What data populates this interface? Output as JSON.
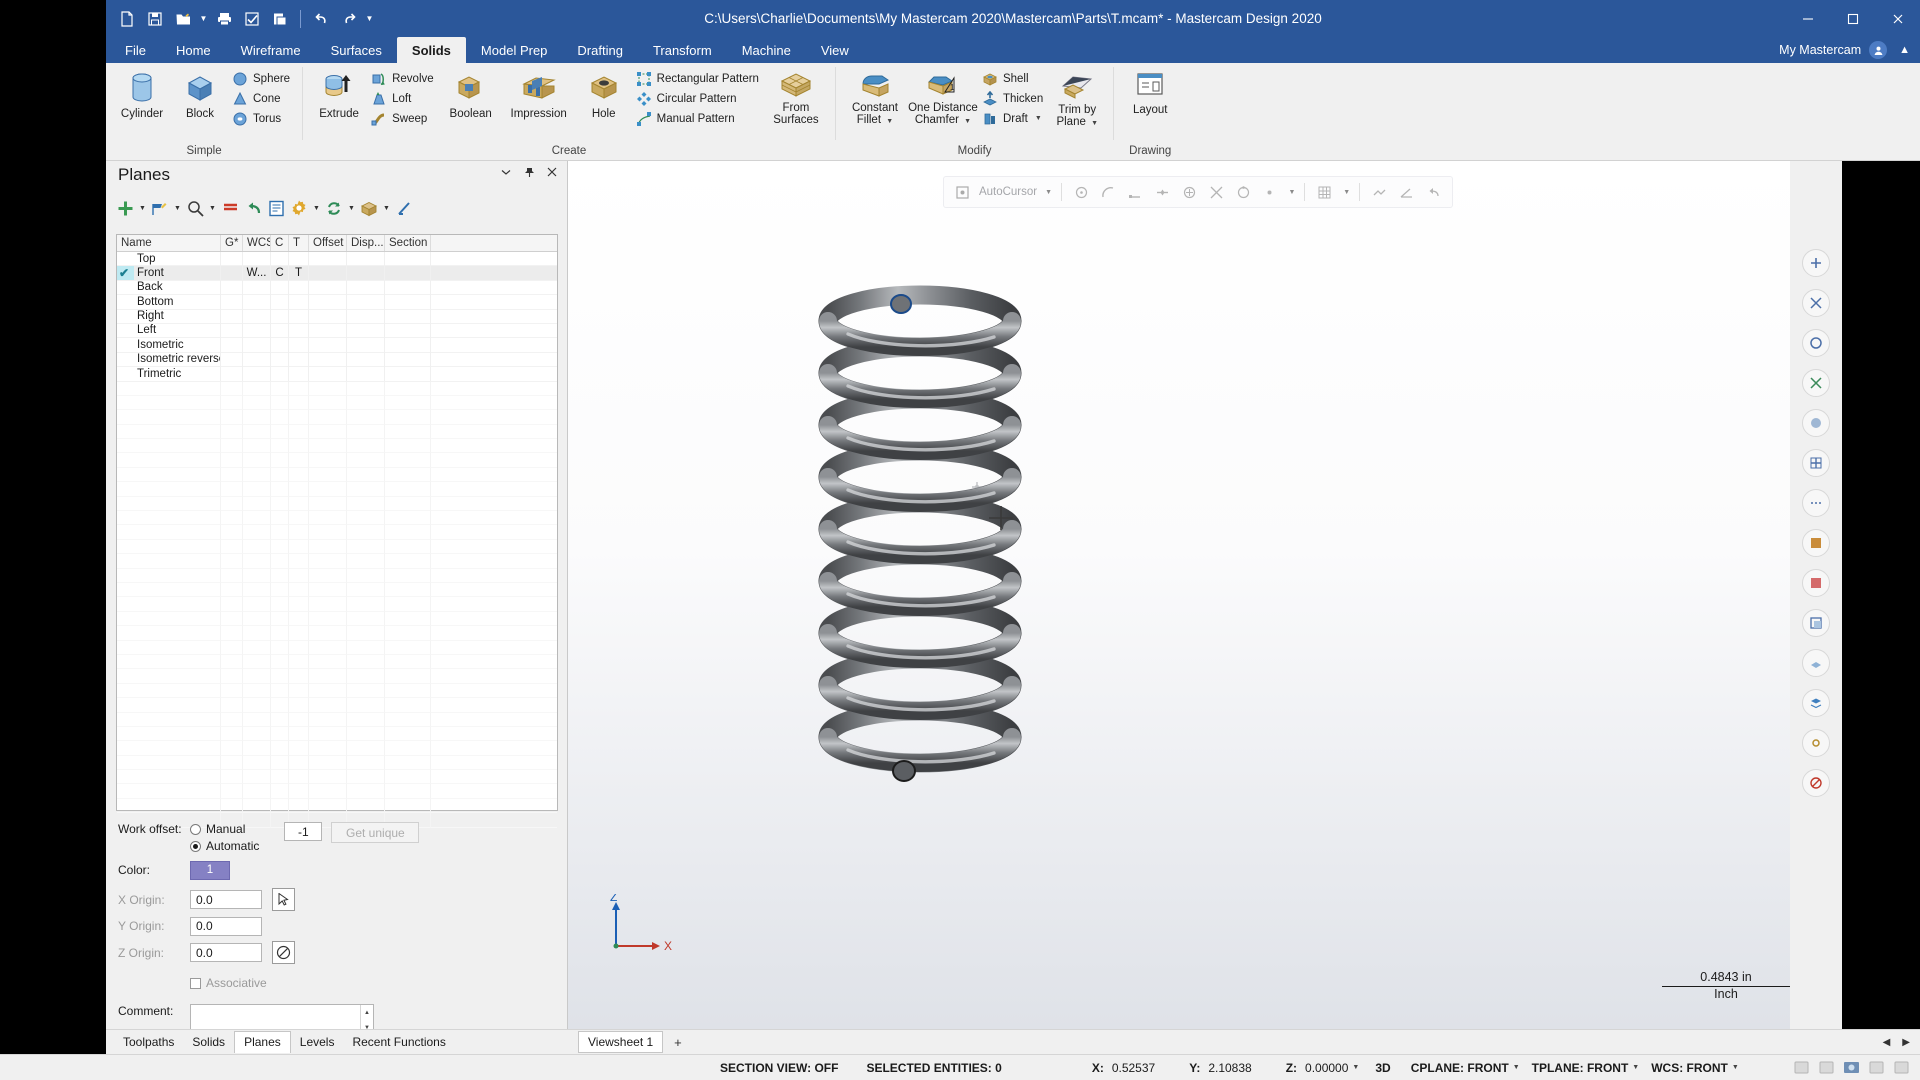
{
  "window": {
    "title": "C:\\Users\\Charlie\\Documents\\My Mastercam 2020\\Mastercam\\Parts\\T.mcam* - Mastercam Design 2020",
    "minimize": "–",
    "maximize": "❐",
    "close": "✕"
  },
  "quick_access": {
    "new": "new-icon",
    "save": "save-icon",
    "open": "open-icon",
    "print": "print-icon",
    "verify": "verify-icon",
    "paste": "paste-icon",
    "undo": "undo-icon",
    "redo": "redo-icon",
    "more": "more-icon"
  },
  "tabs": [
    {
      "label": "File",
      "active": false
    },
    {
      "label": "Home",
      "active": false
    },
    {
      "label": "Wireframe",
      "active": false
    },
    {
      "label": "Surfaces",
      "active": false
    },
    {
      "label": "Solids",
      "active": true
    },
    {
      "label": "Model Prep",
      "active": false
    },
    {
      "label": "Drafting",
      "active": false
    },
    {
      "label": "Transform",
      "active": false
    },
    {
      "label": "Machine",
      "active": false
    },
    {
      "label": "View",
      "active": false
    }
  ],
  "account": {
    "label": "My Mastercam",
    "collapse": "▲"
  },
  "ribbon": {
    "groups": [
      {
        "title": "Simple",
        "big": [
          {
            "label": "Cylinder",
            "icon": "cylinder-icon"
          },
          {
            "label": "Block",
            "icon": "block-icon"
          }
        ],
        "small": [
          {
            "label": "Sphere",
            "icon": "sphere-icon"
          },
          {
            "label": "Cone",
            "icon": "cone-icon"
          },
          {
            "label": "Torus",
            "icon": "torus-icon"
          }
        ]
      },
      {
        "title": "Create",
        "big": [
          {
            "label": "Extrude",
            "icon": "extrude-icon"
          }
        ],
        "small": [
          {
            "label": "Revolve",
            "icon": "revolve-icon"
          },
          {
            "label": "Loft",
            "icon": "loft-icon"
          },
          {
            "label": "Sweep",
            "icon": "sweep-icon"
          }
        ],
        "big2": [
          {
            "label": "Boolean",
            "icon": "boolean-icon"
          },
          {
            "label": "Impression",
            "icon": "impression-icon"
          },
          {
            "label": "Hole",
            "icon": "hole-icon"
          }
        ],
        "small2": [
          {
            "label": "Rectangular Pattern",
            "icon": "rectangular-pattern-icon"
          },
          {
            "label": "Circular Pattern",
            "icon": "circular-pattern-icon"
          },
          {
            "label": "Manual Pattern",
            "icon": "manual-pattern-icon"
          }
        ],
        "big3": [
          {
            "label": "From Surfaces",
            "icon": "from-surfaces-icon"
          }
        ]
      },
      {
        "title": "Modify",
        "big": [
          {
            "label": "Constant Fillet",
            "icon": "constant-fillet-icon",
            "dropdown": true
          },
          {
            "label": "One Distance Chamfer",
            "icon": "one-distance-chamfer-icon",
            "dropdown": true
          }
        ],
        "small": [
          {
            "label": "Shell",
            "icon": "shell-icon"
          },
          {
            "label": "Thicken",
            "icon": "thicken-icon"
          },
          {
            "label": "Draft",
            "icon": "draft-icon",
            "dropdown": true
          }
        ],
        "big2": [
          {
            "label": "Trim by Plane",
            "icon": "trim-by-plane-icon",
            "dropdown": true
          }
        ]
      },
      {
        "title": "Drawing",
        "big": [
          {
            "label": "Layout",
            "icon": "layout-icon"
          }
        ]
      }
    ]
  },
  "planes_panel": {
    "title": "Planes",
    "header_buttons": [
      "chevron-down-icon",
      "pin-icon",
      "close-icon"
    ],
    "toolbar": [
      {
        "name": "add-plane-button",
        "icon": "plus-icon",
        "dropdown": true
      },
      {
        "name": "plane-from-geometry-button",
        "icon": "flag-icon",
        "dropdown": true
      },
      {
        "name": "find-plane-button",
        "icon": "search-icon",
        "dropdown": true
      },
      {
        "name": "align-button",
        "icon": "lines-icon",
        "dropdown": false
      },
      {
        "name": "undo-button",
        "icon": "undo-arrow-icon",
        "dropdown": false
      },
      {
        "name": "list-properties-button",
        "icon": "list-icon",
        "dropdown": false
      },
      {
        "name": "settings-button",
        "icon": "gear-icon",
        "dropdown": true
      },
      {
        "name": "refresh-button",
        "icon": "refresh-icon",
        "dropdown": true
      },
      {
        "name": "package-button",
        "icon": "box-icon",
        "dropdown": true
      },
      {
        "name": "edge-button",
        "icon": "edge-icon",
        "dropdown": false
      }
    ],
    "columns": [
      "Name",
      "G*",
      "WCS",
      "C",
      "T",
      "Offset",
      "Disp...",
      "Section"
    ],
    "rows": [
      {
        "name": "Top",
        "checked": false,
        "selected": false,
        "wcs": "",
        "c": "",
        "t": "",
        "offset": "",
        "disp": "",
        "section": ""
      },
      {
        "name": "Front",
        "checked": true,
        "selected": true,
        "wcs": "W...",
        "c": "C",
        "t": "T",
        "offset": "",
        "disp": "",
        "section": ""
      },
      {
        "name": "Back",
        "checked": false,
        "selected": false,
        "wcs": "",
        "c": "",
        "t": "",
        "offset": "",
        "disp": "",
        "section": ""
      },
      {
        "name": "Bottom",
        "checked": false,
        "selected": false,
        "wcs": "",
        "c": "",
        "t": "",
        "offset": "",
        "disp": "",
        "section": ""
      },
      {
        "name": "Right",
        "checked": false,
        "selected": false,
        "wcs": "",
        "c": "",
        "t": "",
        "offset": "",
        "disp": "",
        "section": ""
      },
      {
        "name": "Left",
        "checked": false,
        "selected": false,
        "wcs": "",
        "c": "",
        "t": "",
        "offset": "",
        "disp": "",
        "section": ""
      },
      {
        "name": "Isometric",
        "checked": false,
        "selected": false,
        "wcs": "",
        "c": "",
        "t": "",
        "offset": "",
        "disp": "",
        "section": ""
      },
      {
        "name": "Isometric reverse",
        "checked": false,
        "selected": false,
        "wcs": "",
        "c": "",
        "t": "",
        "offset": "",
        "disp": "",
        "section": ""
      },
      {
        "name": "Trimetric",
        "checked": false,
        "selected": false,
        "wcs": "",
        "c": "",
        "t": "",
        "offset": "",
        "disp": "",
        "section": ""
      }
    ],
    "properties": {
      "work_offset_label": "Work offset:",
      "manual_label": "Manual",
      "automatic_label": "Automatic",
      "work_offset_mode": "Automatic",
      "work_offset_value": "-1",
      "get_unique_label": "Get unique",
      "color_label": "Color:",
      "color_value": "1",
      "color_hex": "#8581c4",
      "x_origin_label": "X Origin:",
      "x_origin_value": "0.0",
      "y_origin_label": "Y Origin:",
      "y_origin_value": "0.0",
      "z_origin_label": "Z Origin:",
      "z_origin_value": "0.0",
      "associative_label": "Associative",
      "associative_checked": false,
      "comment_label": "Comment:",
      "comment_value": ""
    }
  },
  "bottom_tabs": [
    {
      "label": "Toolpaths",
      "active": false
    },
    {
      "label": "Solids",
      "active": false
    },
    {
      "label": "Planes",
      "active": true
    },
    {
      "label": "Levels",
      "active": false
    },
    {
      "label": "Recent Functions",
      "active": false
    }
  ],
  "viewsheet": {
    "tab_label": "Viewsheet 1",
    "add_label": "+",
    "prev": "◀",
    "next": "▶"
  },
  "viewport": {
    "autocursor_label": "AutoCursor",
    "axis_z": "Z",
    "axis_x": "X",
    "scale_value": "0.4843 in",
    "scale_unit": "Inch",
    "model": "coil-spring"
  },
  "statusbar": {
    "section_view": "SECTION VIEW: OFF",
    "selected_entities": "SELECTED ENTITIES: 0",
    "x_label": "X:",
    "x_value": "0.52537",
    "y_label": "Y:",
    "y_value": "2.10838",
    "z_label": "Z:",
    "z_value": "0.00000",
    "dimension_mode": "3D",
    "cplane": "CPLANE: FRONT",
    "tplane": "TPLANE: FRONT",
    "wcs": "WCS: FRONT"
  }
}
